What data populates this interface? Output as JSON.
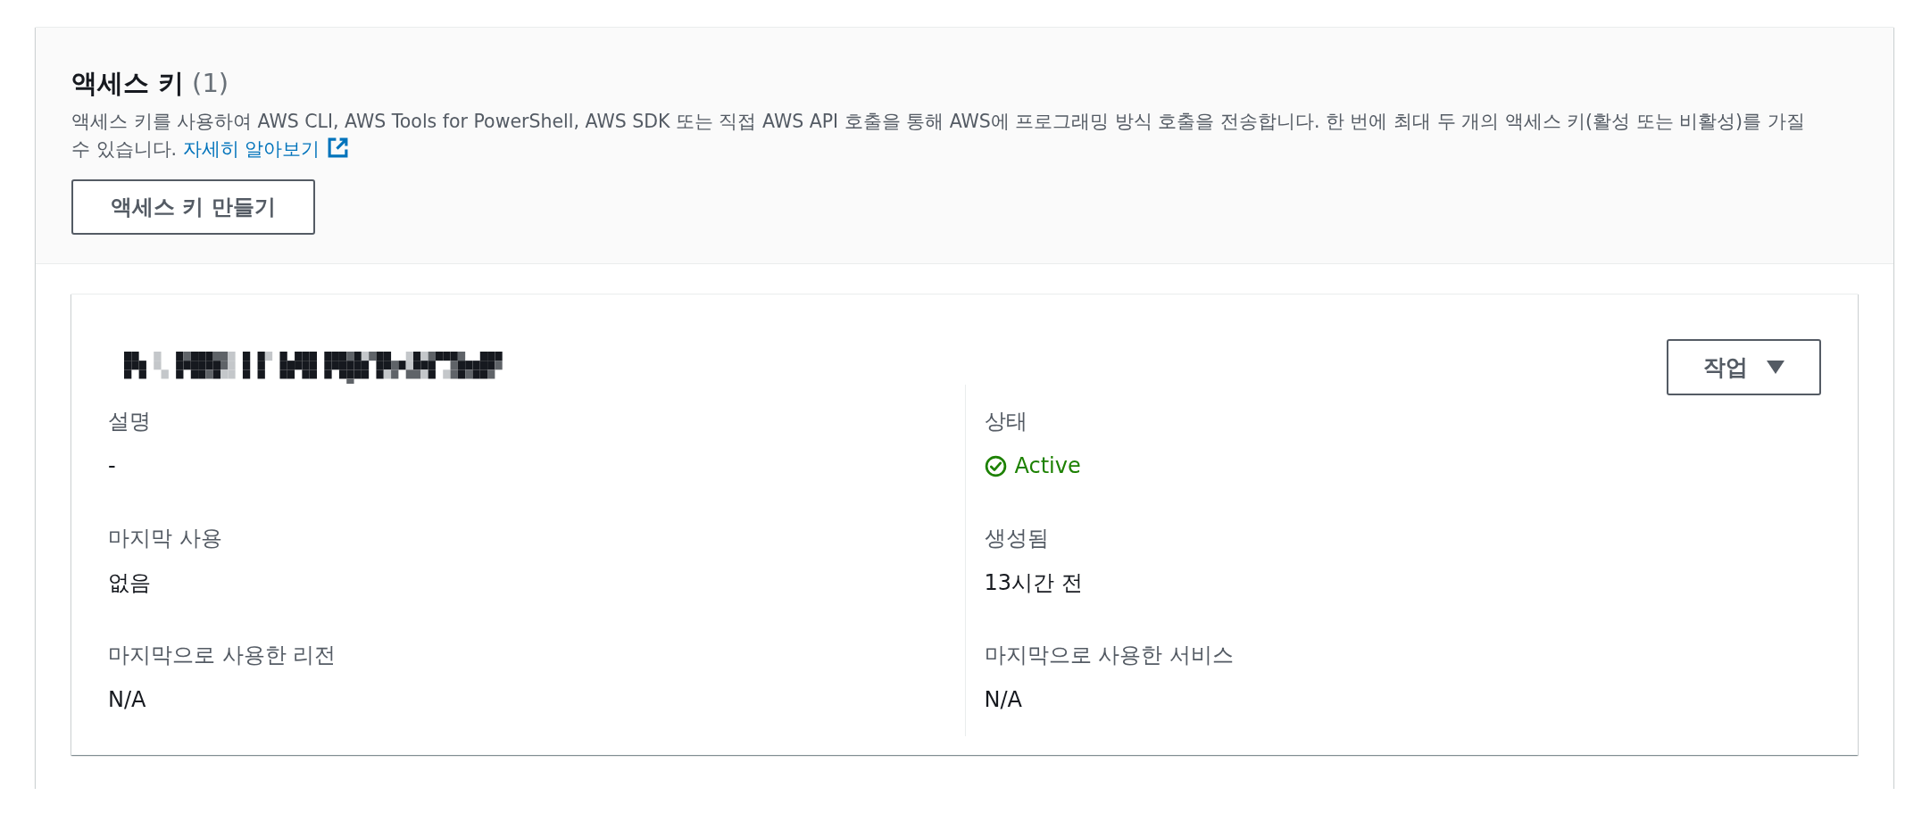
{
  "panel": {
    "title": "액세스 키",
    "count": "(1)",
    "description": "액세스 키를 사용하여 AWS CLI, AWS Tools for PowerShell, AWS SDK 또는 직접 AWS API 호출을 통해 AWS에 프로그래밍 방식 호출을 전송합니다. 한 번에 최대 두 개의 액세스 키(활성 또는 비활성)를 가질 수 있습니다.",
    "learn_more_link": "자세히 알아보기",
    "create_button": "액세스 키 만들기"
  },
  "access_keys": [
    {
      "actions_button": "작업",
      "columns": [
        [
          {
            "label": "설명",
            "value": "-",
            "kind": "text"
          },
          {
            "label": "마지막 사용",
            "value": "없음",
            "kind": "text"
          },
          {
            "label": "마지막으로 사용한 리전",
            "value": "N/A",
            "kind": "text"
          }
        ],
        [
          {
            "label": "상태",
            "value": "Active",
            "kind": "status"
          },
          {
            "label": "생성됨",
            "value": "13시간 전",
            "kind": "text"
          },
          {
            "label": "마지막으로 사용한 서비스",
            "value": "N/A",
            "kind": "text"
          }
        ]
      ]
    }
  ]
}
